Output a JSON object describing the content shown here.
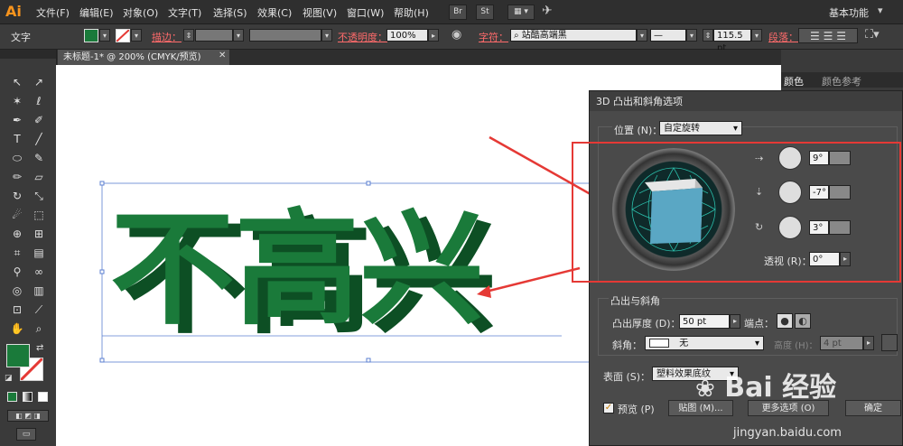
{
  "app": {
    "logo": "Ai",
    "workspace": "基本功能"
  },
  "menu": [
    "文件(F)",
    "编辑(E)",
    "对象(O)",
    "文字(T)",
    "选择(S)",
    "效果(C)",
    "视图(V)",
    "窗口(W)",
    "帮助(H)"
  ],
  "menubar_icons": {
    "br": "Br",
    "st": "St"
  },
  "control": {
    "selection_label": "文字",
    "stroke_label": "描边：",
    "opacity_label": "不透明度：",
    "opacity_value": "100%",
    "char_label": "字符：",
    "font_name": "站酷高端黑",
    "font_size": "115.5 pt",
    "para_label": "段落："
  },
  "document_tab": "未标题-1* @ 200% (CMYK/预览)",
  "panels": {
    "color_tab": "颜色",
    "color_ref_tab": "颜色参考"
  },
  "artwork": {
    "text": "不高兴",
    "color": "#1a7a3a"
  },
  "dialog": {
    "title": "3D 凸出和斜角选项",
    "position_label": "位置 (N)：",
    "position_value": "自定旋转",
    "rotation_x": "9°",
    "rotation_y": "-7°",
    "rotation_z": "3°",
    "perspective_label": "透视 (R)：",
    "perspective_value": "0°",
    "extrude_section": "凸出与斜角",
    "extrude_depth_label": "凸出厚度 (D)：",
    "extrude_depth_value": "50 pt",
    "cap_label": "端点：",
    "bevel_label": "斜角：",
    "bevel_value": "无",
    "height_label": "高度 (H)：",
    "height_value": "4 pt",
    "surface_label": "表面 (S)：",
    "surface_value": "塑料效果底纹",
    "preview_label": "预览 (P)",
    "map_button": "贴图 (M)...",
    "more_button": "更多选项 (O)",
    "ok_button": "确定"
  },
  "watermark": {
    "brand": "Bai 经验",
    "url": "jingyan.baidu.com"
  },
  "colors": {
    "accent_red": "#e53935",
    "fill_green": "#1a7a3a",
    "cube_blue": "#5aa7c4",
    "ai_orange": "#f7941d"
  }
}
